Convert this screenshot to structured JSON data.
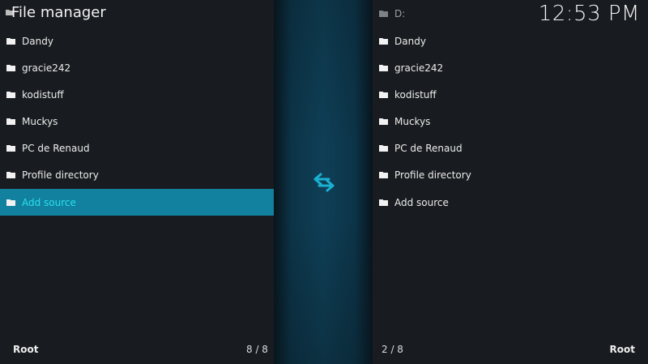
{
  "window": {
    "title": "File manager",
    "clock": "12:53 PM"
  },
  "left_pane": {
    "items": [
      {
        "label": "Dandy",
        "icon": "folder-icon"
      },
      {
        "label": "gracie242",
        "icon": "folder-icon"
      },
      {
        "label": "kodistuff",
        "icon": "folder-icon"
      },
      {
        "label": "Muckys",
        "icon": "folder-icon"
      },
      {
        "label": "PC de Renaud",
        "icon": "folder-icon"
      },
      {
        "label": "Profile directory",
        "icon": "folder-icon"
      },
      {
        "label": "Add source",
        "icon": "folder-icon",
        "selected": true
      }
    ],
    "footer_left": "Root",
    "footer_count": "8 / 8"
  },
  "right_pane": {
    "items": [
      {
        "label": "D:",
        "icon": "folder-icon"
      },
      {
        "label": "Dandy",
        "icon": "folder-icon"
      },
      {
        "label": "gracie242",
        "icon": "folder-icon"
      },
      {
        "label": "kodistuff",
        "icon": "folder-icon"
      },
      {
        "label": "Muckys",
        "icon": "folder-icon"
      },
      {
        "label": "PC de Renaud",
        "icon": "folder-icon"
      },
      {
        "label": "Profile directory",
        "icon": "folder-icon"
      },
      {
        "label": "Add source",
        "icon": "folder-icon"
      }
    ],
    "footer_count": "2 / 8",
    "footer_right": "Root"
  },
  "center": {
    "icon": "swap-arrows-icon"
  },
  "colors": {
    "selection_bg": "#12819f",
    "selection_text": "#27e0ee",
    "accent": "#1ab0d2"
  }
}
